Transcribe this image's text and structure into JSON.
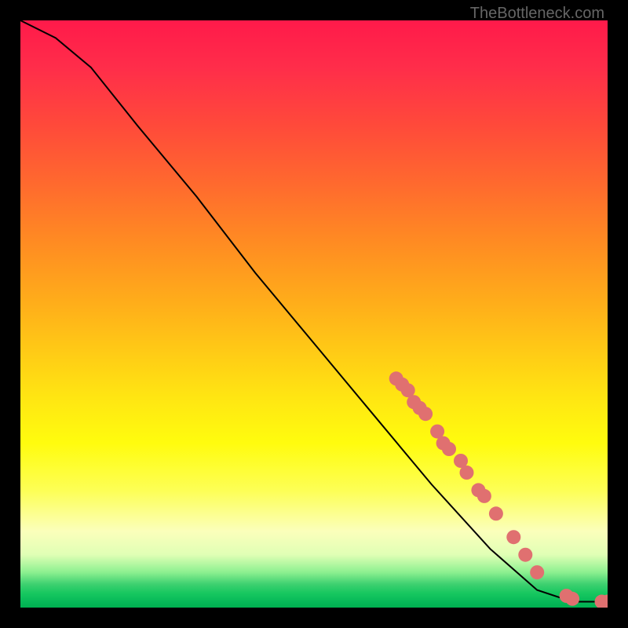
{
  "watermark": "TheBottleneck.com",
  "chart_data": {
    "type": "line",
    "title": "",
    "xlabel": "",
    "ylabel": "",
    "xlim": [
      0,
      100
    ],
    "ylim": [
      0,
      100
    ],
    "curve": [
      {
        "x": 0,
        "y": 100
      },
      {
        "x": 6,
        "y": 97
      },
      {
        "x": 12,
        "y": 92
      },
      {
        "x": 20,
        "y": 82
      },
      {
        "x": 30,
        "y": 70
      },
      {
        "x": 40,
        "y": 57
      },
      {
        "x": 50,
        "y": 45
      },
      {
        "x": 60,
        "y": 33
      },
      {
        "x": 70,
        "y": 21
      },
      {
        "x": 80,
        "y": 10
      },
      {
        "x": 88,
        "y": 3
      },
      {
        "x": 94,
        "y": 1
      },
      {
        "x": 100,
        "y": 1
      }
    ],
    "markers": [
      {
        "x": 64,
        "y": 39
      },
      {
        "x": 65,
        "y": 38
      },
      {
        "x": 66,
        "y": 37
      },
      {
        "x": 67,
        "y": 35
      },
      {
        "x": 68,
        "y": 34
      },
      {
        "x": 69,
        "y": 33
      },
      {
        "x": 71,
        "y": 30
      },
      {
        "x": 72,
        "y": 28
      },
      {
        "x": 73,
        "y": 27
      },
      {
        "x": 75,
        "y": 25
      },
      {
        "x": 76,
        "y": 23
      },
      {
        "x": 78,
        "y": 20
      },
      {
        "x": 79,
        "y": 19
      },
      {
        "x": 81,
        "y": 16
      },
      {
        "x": 84,
        "y": 12
      },
      {
        "x": 86,
        "y": 9
      },
      {
        "x": 88,
        "y": 6
      },
      {
        "x": 93,
        "y": 2
      },
      {
        "x": 94,
        "y": 1.5
      },
      {
        "x": 99,
        "y": 1
      },
      {
        "x": 100,
        "y": 1
      }
    ],
    "marker_color": "#e07070",
    "marker_radius": 9,
    "line_color": "#000000"
  }
}
